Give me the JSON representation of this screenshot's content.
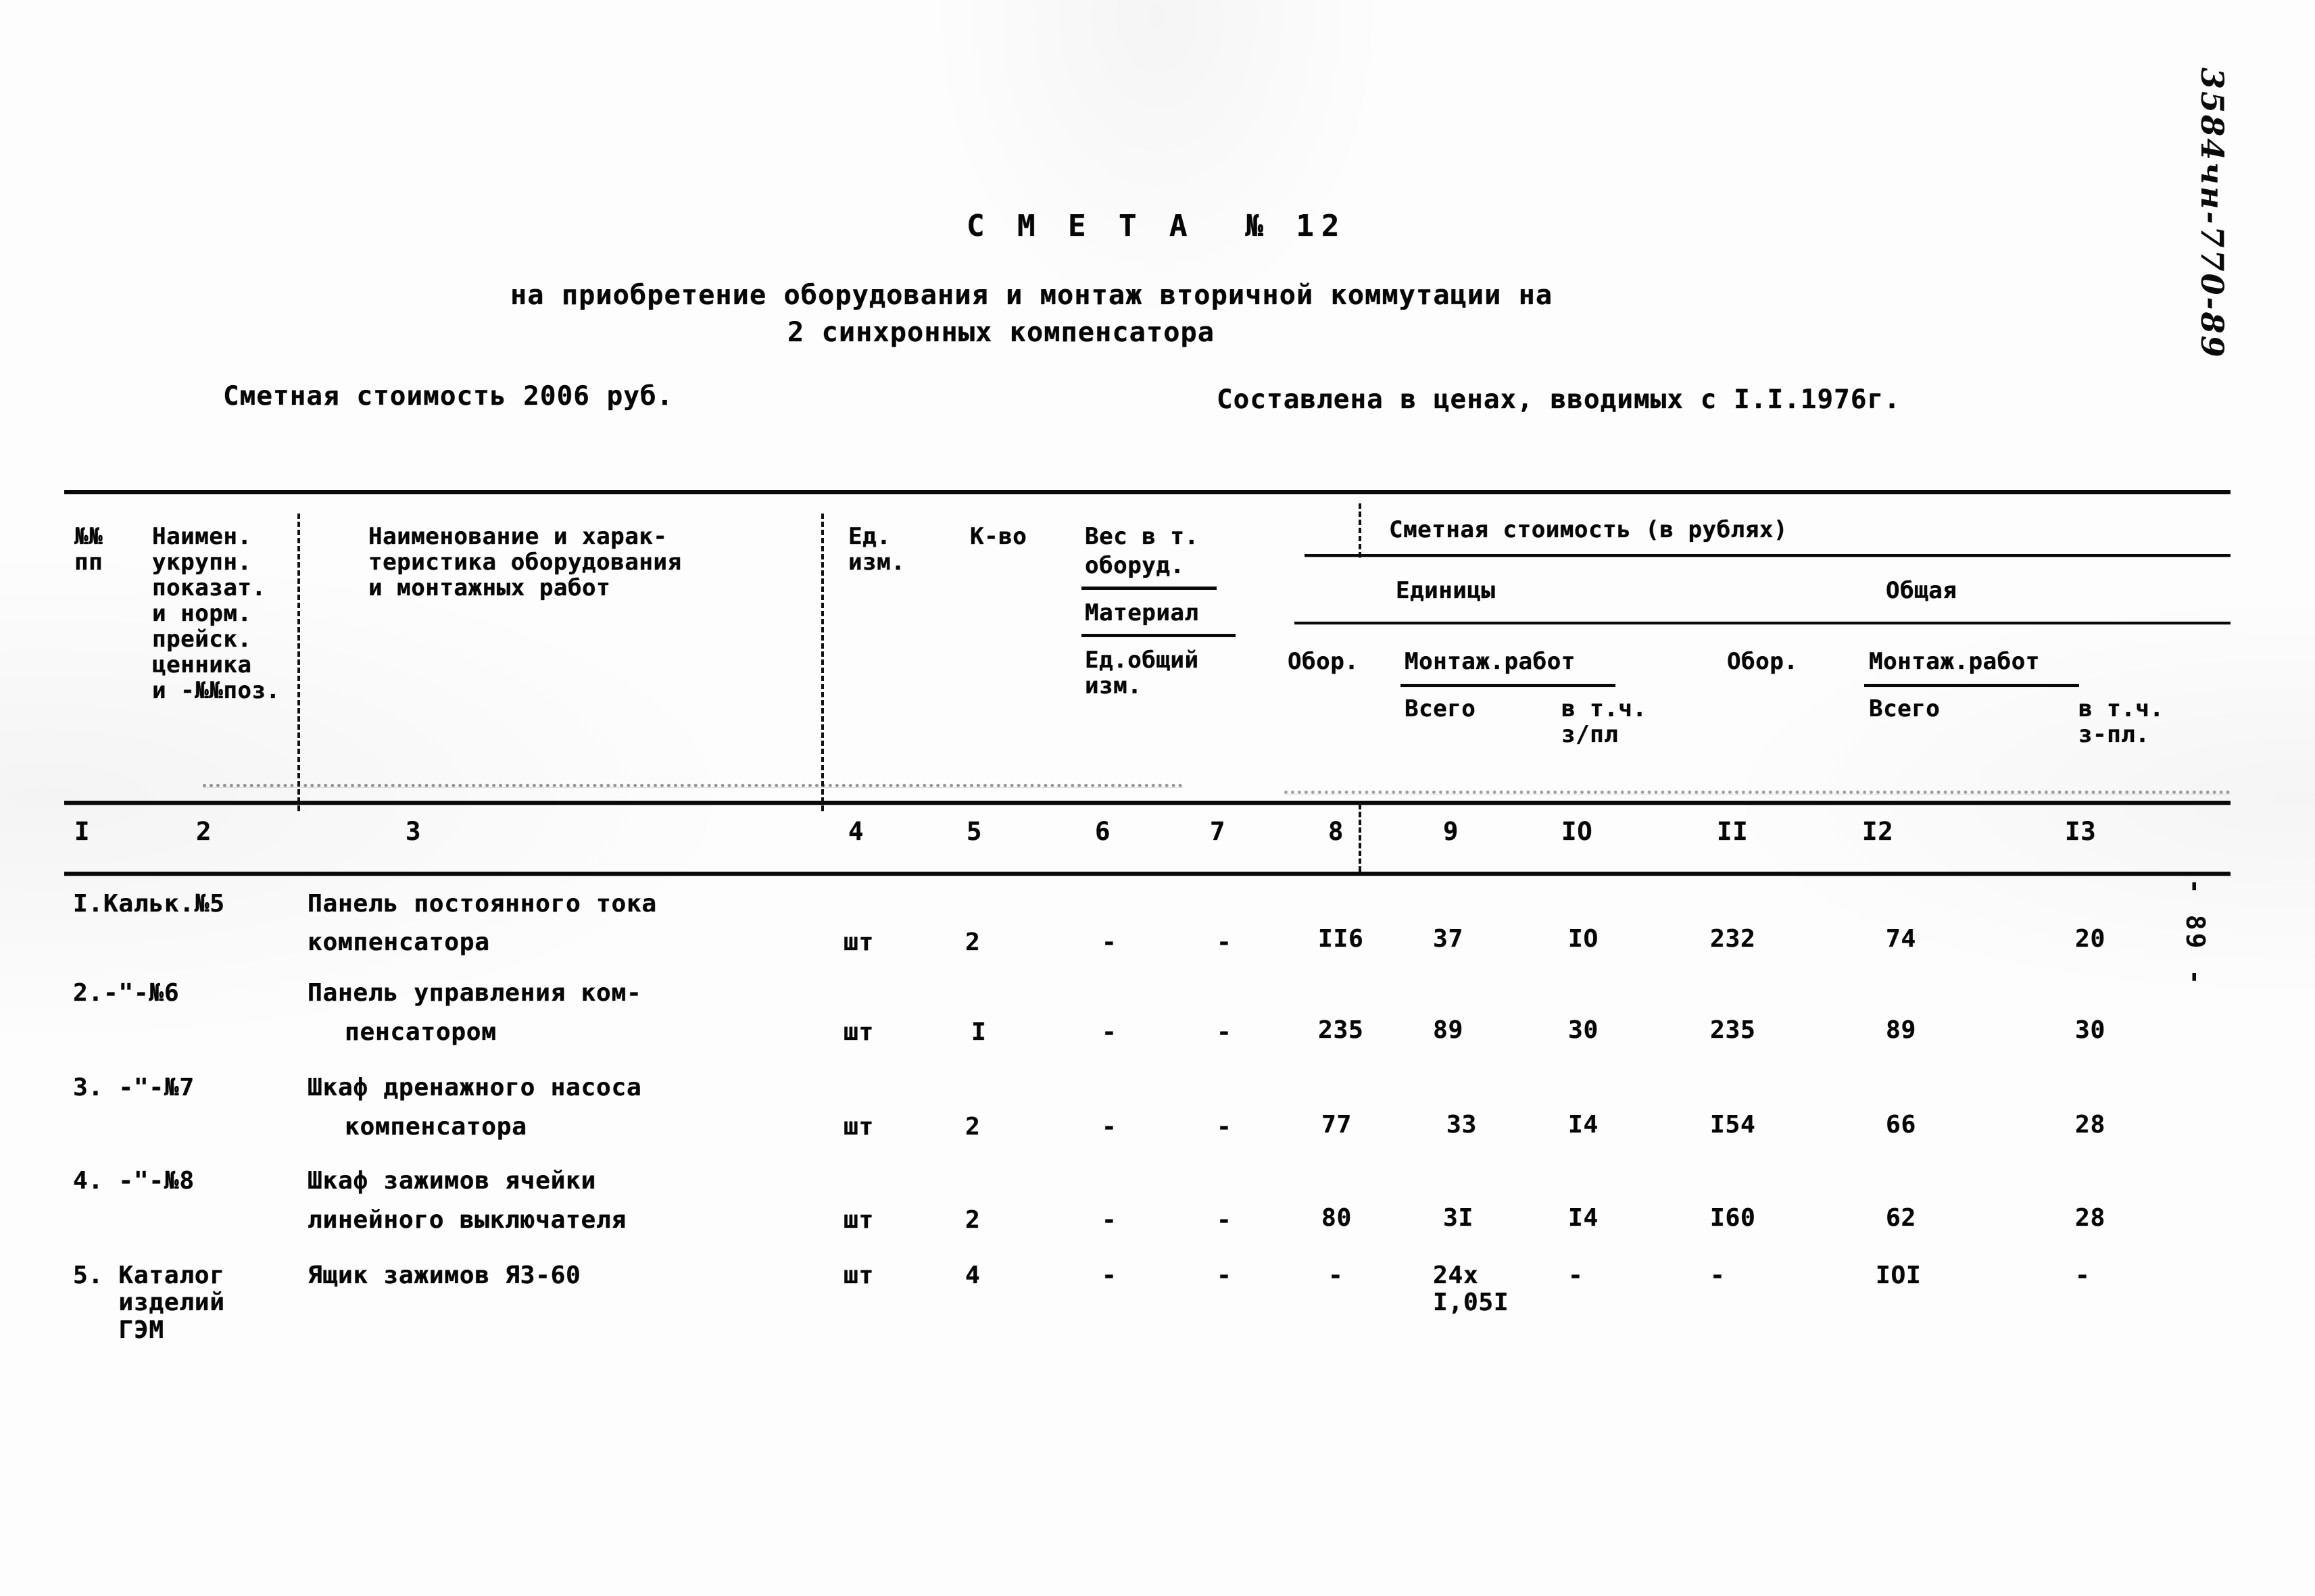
{
  "document": {
    "title": "С М Е Т А  № 12",
    "subtitle_line1": "на приобретение оборудования и монтаж вторичной коммутации на",
    "subtitle_line2": "2 синхронных компенсатора",
    "estimate_cost": "Сметная стоимость 2006 руб.",
    "prices_note": "Составлена в ценах, вводимых с I.I.1976г.",
    "archive_code": "3584чн-770-89",
    "page_marker": "- 89 -"
  },
  "table": {
    "header": {
      "col1": "№№\nпп",
      "col2": "Наимен.\nукрупн.\nпоказат.\nи норм.\nпрейск.\nценника\nи -№№поз.",
      "col3": "Наименование и харак-\nтеристика оборудования\nи монтажных работ",
      "col4": "Ед.\nизм.",
      "col5": "К-во",
      "col6_7_title": "Вес в т.",
      "col6_7_line1": "оборуд.",
      "col6_7_line2": "Материал",
      "col6_7_line3": "Ед.общий\nизм.",
      "cost_group": "Сметная стоимость (в рублях)",
      "unit_group": "Единицы",
      "total_group": "Общая",
      "unit_equipment": "Обор.",
      "unit_install": "Монтаж.работ",
      "unit_install_all": "Всего",
      "unit_install_incl": "в т.ч.\nз/пл",
      "total_equipment": "Обор.",
      "total_install": "Монтаж.работ",
      "total_install_all": "Всего",
      "total_install_incl": "в т.ч.\nз-пл."
    },
    "column_numbers": [
      "I",
      "2",
      "3",
      "4",
      "5",
      "6",
      "7",
      "8",
      "9",
      "IO",
      "II",
      "I2",
      "I3"
    ],
    "rows": [
      {
        "num": "I.Кальк.№5",
        "name_line1": "Панель постоянного тока",
        "name_line2": "компенсатора",
        "unit": "шт",
        "qty": "2",
        "weight_equip": "-",
        "weight_material": "-",
        "unit_equip": "II6",
        "unit_install_all": "37",
        "unit_install_zp": "IO",
        "total_equip": "232",
        "total_install_all": "74",
        "total_install_zp": "20"
      },
      {
        "num": "2.-\"-№6",
        "name_line1": "Панель управления ком-",
        "name_line2": "пенсатором",
        "unit": "шт",
        "qty": "I",
        "weight_equip": "-",
        "weight_material": "-",
        "unit_equip": "235",
        "unit_install_all": "89",
        "unit_install_zp": "30",
        "total_equip": "235",
        "total_install_all": "89",
        "total_install_zp": "30"
      },
      {
        "num": "3. -\"-№7",
        "name_line1": "Шкаф дренажного насоса",
        "name_line2": "компенсатора",
        "unit": "шт",
        "qty": "2",
        "weight_equip": "-",
        "weight_material": "-",
        "unit_equip": "77",
        "unit_install_all": "33",
        "unit_install_zp": "I4",
        "total_equip": "I54",
        "total_install_all": "66",
        "total_install_zp": "28"
      },
      {
        "num": "4. -\"-№8",
        "name_line1": "Шкаф зажимов ячейки",
        "name_line2": "линейного выключателя",
        "unit": "шт",
        "qty": "2",
        "weight_equip": "-",
        "weight_material": "-",
        "unit_equip": "80",
        "unit_install_all": "3I",
        "unit_install_zp": "I4",
        "total_equip": "I60",
        "total_install_all": "62",
        "total_install_zp": "28"
      },
      {
        "num": "5. Каталог\n   изделий\n   ГЭМ",
        "name_line1": "Ящик зажимов ЯЗ-60",
        "name_line2": "",
        "unit": "шт",
        "qty": "4",
        "weight_equip": "-",
        "weight_material": "-",
        "unit_equip": "-",
        "unit_install_all": "24х\nI,05I",
        "unit_install_zp": "-",
        "total_equip": "-",
        "total_install_all": "IOI",
        "total_install_zp": "-"
      }
    ]
  }
}
